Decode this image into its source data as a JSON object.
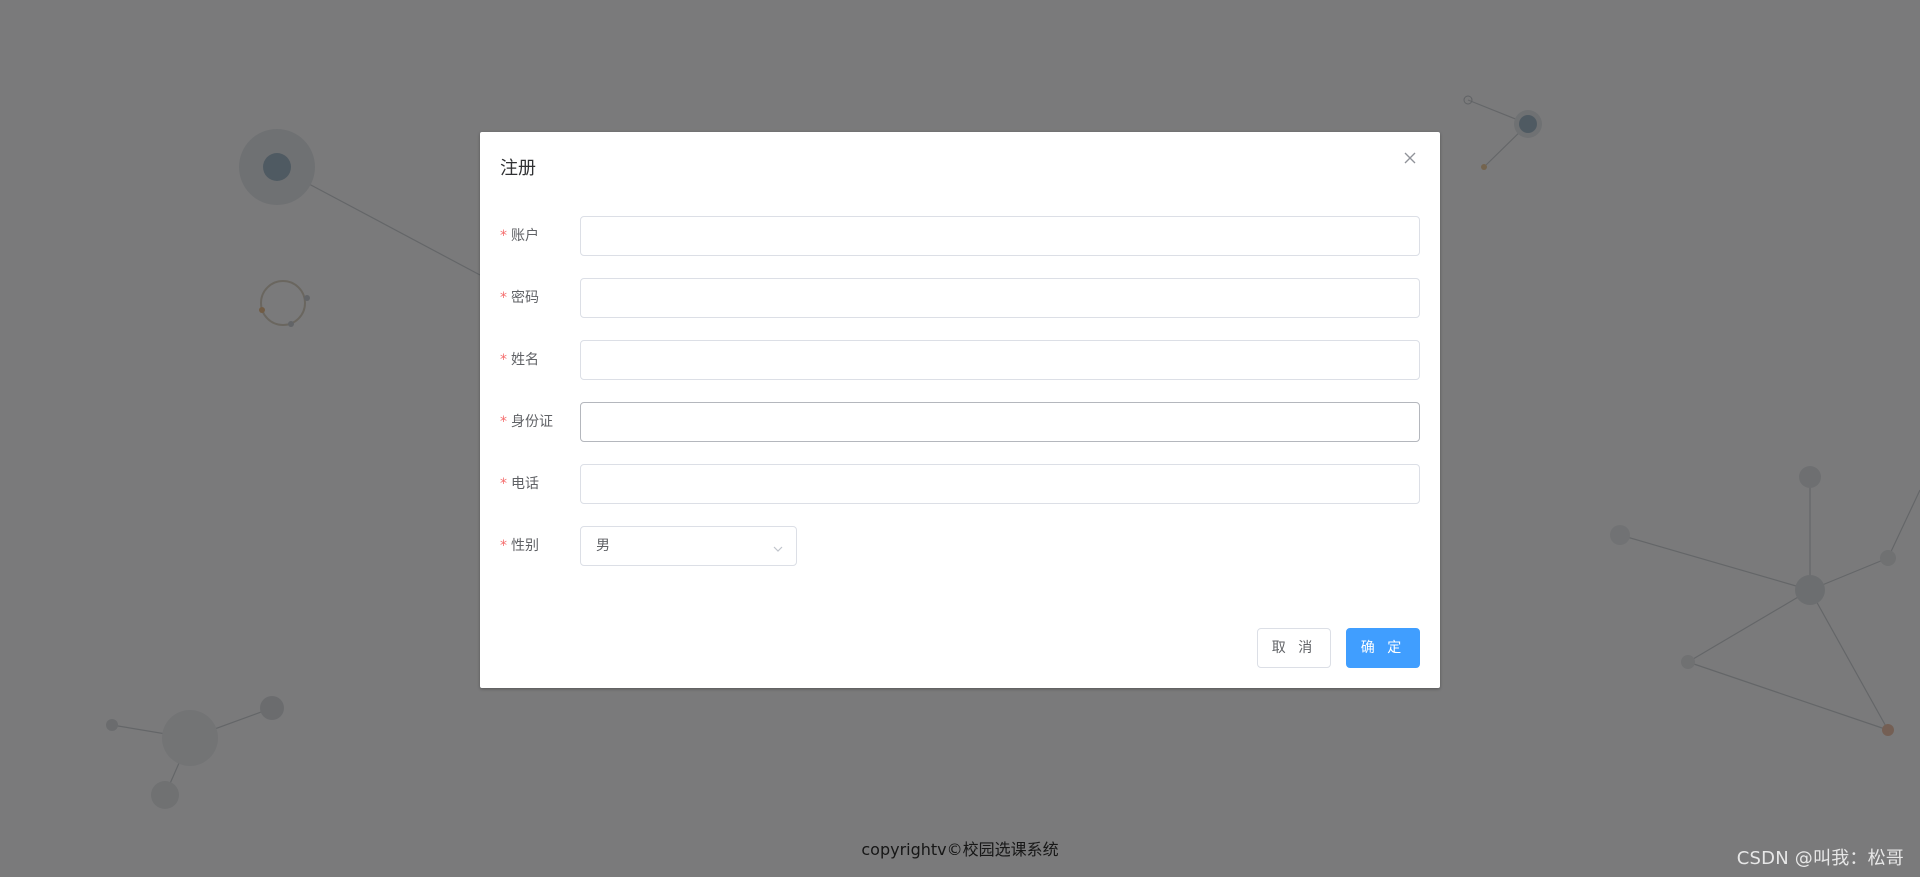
{
  "dialog": {
    "title": "注册",
    "close_icon": "close-icon"
  },
  "form": {
    "required_mark": "*",
    "fields": [
      {
        "label": "账户",
        "value": ""
      },
      {
        "label": "密码",
        "value": ""
      },
      {
        "label": "姓名",
        "value": ""
      },
      {
        "label": "身份证",
        "value": ""
      },
      {
        "label": "电话",
        "value": ""
      }
    ],
    "gender": {
      "label": "性别",
      "value": "男"
    }
  },
  "buttons": {
    "cancel": "取 消",
    "confirm": "确 定"
  },
  "footer": {
    "copyright": "copyrightv©校园选课系统"
  },
  "watermark": "CSDN @叫我：松哥",
  "colors": {
    "primary": "#409eff",
    "required": "#f56c6c",
    "overlay": "rgba(0,0,0,0.5)"
  }
}
